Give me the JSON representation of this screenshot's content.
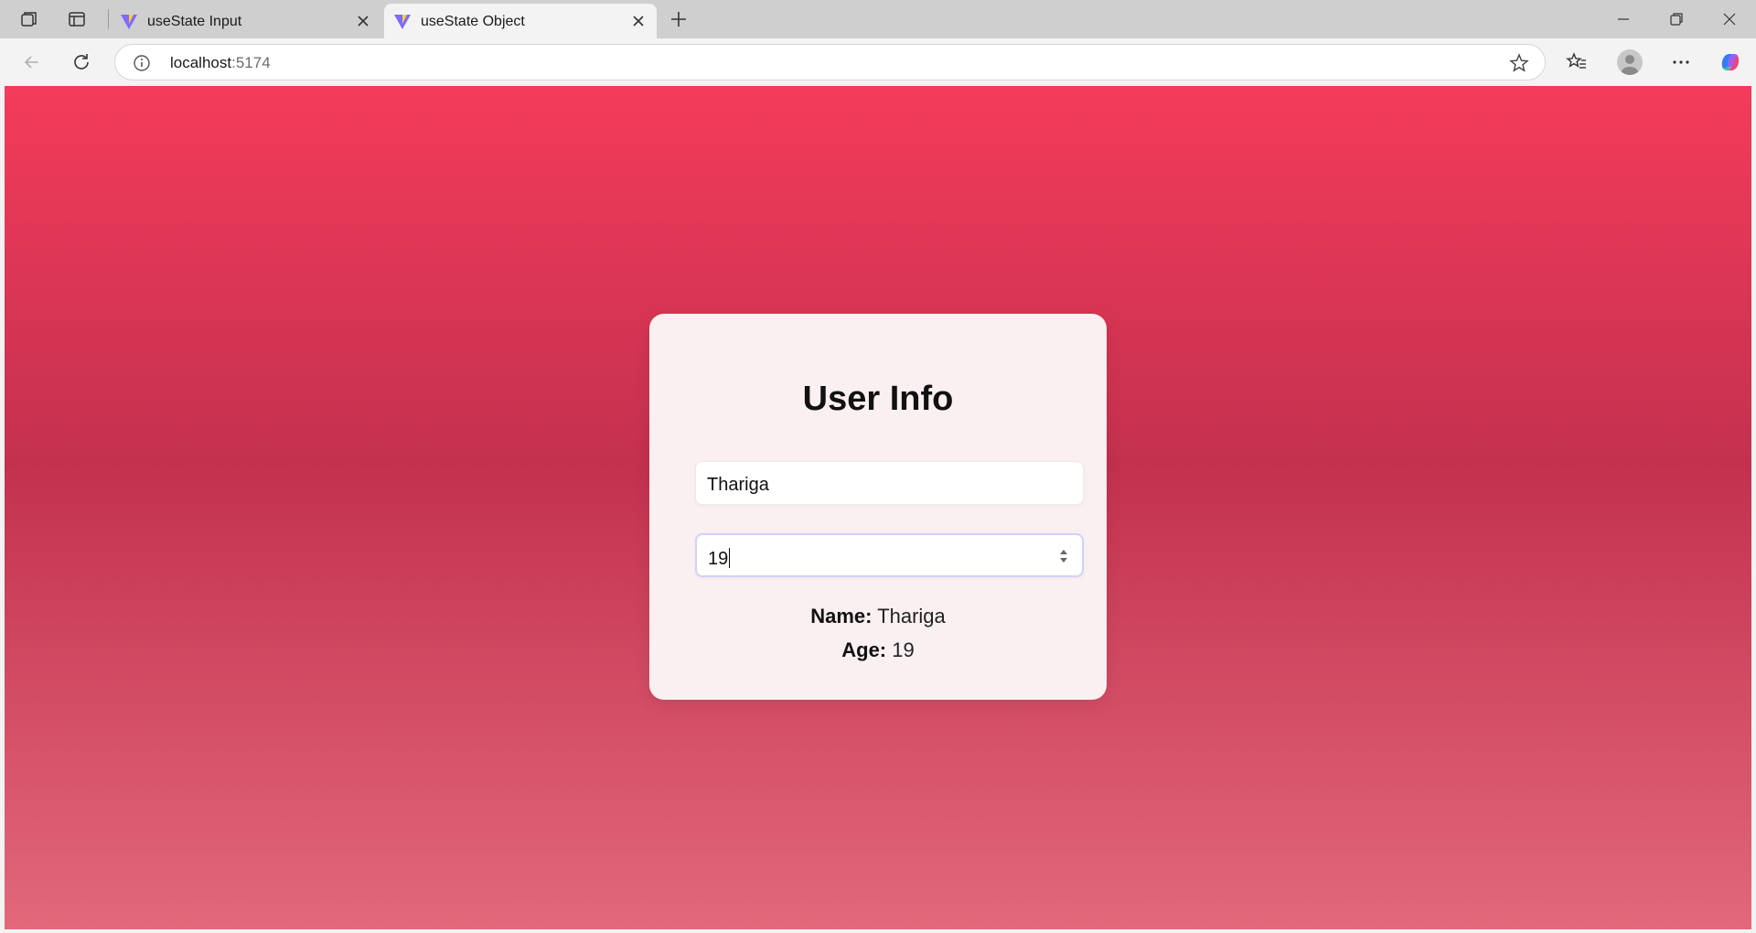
{
  "browser": {
    "tabs": [
      {
        "title": "useState Input",
        "active": false
      },
      {
        "title": "useState Object",
        "active": true
      }
    ],
    "address": {
      "host": "localhost",
      "port": ":5174"
    }
  },
  "page": {
    "card_title": "User Info",
    "name_input": {
      "value": "Thariga"
    },
    "age_input": {
      "value": "19"
    },
    "summary": {
      "name_label": "Name:",
      "name_value": "Thariga",
      "age_label": "Age:",
      "age_value": "19"
    }
  },
  "colors": {
    "gradient_top": "#f43b5a",
    "gradient_mid": "#c3314f",
    "gradient_bottom": "#e2687a",
    "card_bg": "#faf0f1",
    "focus_ring": "#cdd3fb"
  }
}
